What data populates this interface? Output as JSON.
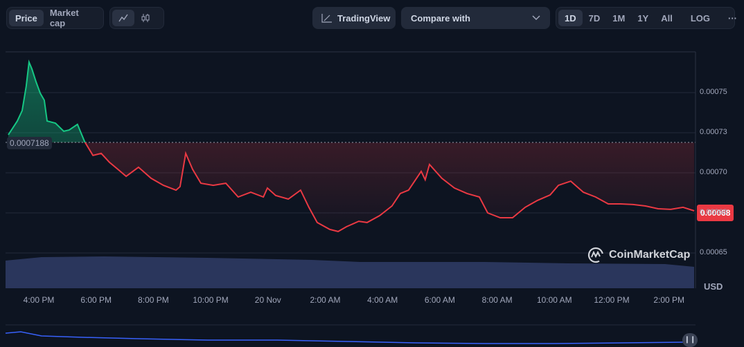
{
  "toolbar": {
    "price_tab": "Price",
    "market_cap_tab": "Market cap",
    "line_chart_icon": "line-chart-icon",
    "candle_chart_icon": "candlestick-icon",
    "tradingview_label": "TradingView",
    "compare_label": "Compare with",
    "ranges": [
      "1D",
      "7D",
      "1M",
      "1Y",
      "All"
    ],
    "active_range": "1D",
    "log_label": "LOG",
    "more_label": "···"
  },
  "colors": {
    "up": "#16c784",
    "down": "#ea3943",
    "volume": "#2e3a63",
    "background": "#0d1421"
  },
  "watermark": "CoinMarketCap",
  "chart_data": {
    "type": "line",
    "title": "",
    "xlabel": "",
    "ylabel": "USD",
    "x_unit": "hours since 4:00 PM",
    "x_tick_labels": [
      "4:00 PM",
      "6:00 PM",
      "8:00 PM",
      "10:00 PM",
      "20 Nov",
      "2:00 AM",
      "4:00 AM",
      "6:00 AM",
      "8:00 AM",
      "10:00 AM",
      "12:00 PM",
      "2:00 PM"
    ],
    "y_tick_labels": [
      "0.00075",
      "0.00073",
      "0.00070",
      "0.00068",
      "0.00065"
    ],
    "y_ticks": [
      0.00075,
      0.000725,
      0.0007,
      0.000675,
      0.00065
    ],
    "ylim": [
      0.00063,
      0.000785
    ],
    "baseline": 0.0007188,
    "baseline_label": "0.0007188",
    "current_price_label": "0.00068",
    "currency_label": "USD",
    "x": [
      -1.06,
      -0.75,
      -0.58,
      -0.44,
      -0.34,
      -0.24,
      -0.1,
      0.05,
      0.19,
      0.29,
      0.58,
      0.87,
      1.06,
      1.35,
      1.6,
      1.89,
      2.18,
      2.47,
      2.76,
      3.05,
      3.48,
      3.92,
      4.35,
      4.79,
      4.93,
      5.13,
      5.37,
      5.66,
      6.09,
      6.53,
      6.96,
      7.4,
      7.84,
      7.98,
      8.27,
      8.71,
      9.14,
      9.43,
      9.72,
      10.16,
      10.45,
      10.74,
      11.17,
      11.46,
      11.9,
      12.33,
      12.62,
      12.91,
      13.35,
      13.49,
      13.64,
      14.07,
      14.51,
      14.95,
      15.38,
      15.67,
      16.11,
      16.54,
      16.98,
      17.41,
      17.85,
      18.14,
      18.57,
      19.01,
      19.44,
      19.88,
      20.31,
      20.75,
      21.18,
      21.62,
      22.06,
      22.49,
      22.88
    ],
    "series": [
      {
        "name": "Price",
        "values": [
          0.0007237,
          0.0007323,
          0.0007388,
          0.0007539,
          0.000769,
          0.0007647,
          0.0007569,
          0.0007496,
          0.0007453,
          0.0007323,
          0.000731,
          0.0007259,
          0.0007267,
          0.0007302,
          0.0007194,
          0.0007108,
          0.0007121,
          0.0007065,
          0.0007022,
          0.0006978,
          0.0007035,
          0.0006966,
          0.0006922,
          0.0006892,
          0.0006914,
          0.0007121,
          0.0007022,
          0.0006935,
          0.0006922,
          0.0006935,
          0.0006849,
          0.0006879,
          0.0006849,
          0.0006905,
          0.0006858,
          0.0006836,
          0.0006892,
          0.0006785,
          0.000669,
          0.0006647,
          0.0006634,
          0.0006664,
          0.0006698,
          0.000669,
          0.0006733,
          0.0006793,
          0.0006871,
          0.0006892,
          0.0007009,
          0.0006957,
          0.0007052,
          0.0006966,
          0.0006905,
          0.0006871,
          0.0006849,
          0.000675,
          0.000672,
          0.000672,
          0.0006785,
          0.0006828,
          0.0006862,
          0.0006922,
          0.0006948,
          0.0006879,
          0.0006849,
          0.0006806,
          0.0006806,
          0.0006802,
          0.0006793,
          0.0006776,
          0.0006772,
          0.0006785,
          0.0006763
        ]
      }
    ]
  }
}
